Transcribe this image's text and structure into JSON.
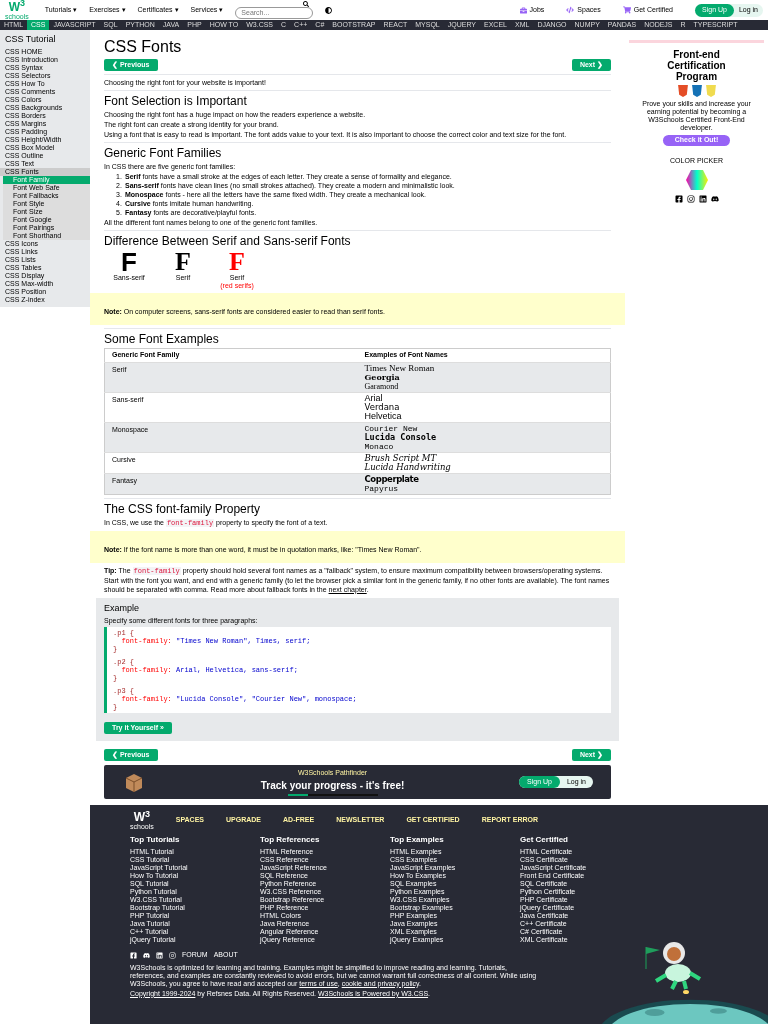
{
  "header": {
    "logo": {
      "mark": "W$^{3}$",
      "word": "schools"
    },
    "menus": [
      "Tutorials ▾",
      "Exercises ▾",
      "Certificates ▾",
      "Services ▾"
    ],
    "search": {
      "placeholder": "Search..."
    },
    "links": [
      {
        "label": "Jobs",
        "kind": "jobs"
      },
      {
        "label": "Spaces",
        "kind": "spaces"
      },
      {
        "label": "Get Certified",
        "kind": "cart"
      }
    ],
    "sign_up": "Sign Up",
    "log_in": "Log in"
  },
  "topics": [
    {
      "label": "HTML",
      "selected": false
    },
    {
      "label": "CSS",
      "selected": true
    },
    {
      "label": "JAVASCRIPT",
      "selected": false
    },
    {
      "label": "SQL",
      "selected": false
    },
    {
      "label": "PYTHON",
      "selected": false
    },
    {
      "label": "JAVA",
      "selected": false
    },
    {
      "label": "PHP",
      "selected": false
    },
    {
      "label": "HOW TO",
      "selected": false
    },
    {
      "label": "W3.CSS",
      "selected": false
    },
    {
      "label": "C",
      "selected": false
    },
    {
      "label": "C++",
      "selected": false
    },
    {
      "label": "C#",
      "selected": false
    },
    {
      "label": "BOOTSTRAP",
      "selected": false
    },
    {
      "label": "REACT",
      "selected": false
    },
    {
      "label": "MYSQL",
      "selected": false
    },
    {
      "label": "JQUERY",
      "selected": false
    },
    {
      "label": "EXCEL",
      "selected": false
    },
    {
      "label": "XML",
      "selected": false
    },
    {
      "label": "DJANGO",
      "selected": false
    },
    {
      "label": "NUMPY",
      "selected": false
    },
    {
      "label": "PANDAS",
      "selected": false
    },
    {
      "label": "NODEJS",
      "selected": false
    },
    {
      "label": "R",
      "selected": false
    },
    {
      "label": "TYPESCRIPT",
      "selected": false
    }
  ],
  "sidebar": {
    "title": "CSS Tutorial",
    "items": [
      {
        "label": "CSS HOME",
        "selected": false
      },
      {
        "label": "CSS Introduction",
        "selected": false
      },
      {
        "label": "CSS Syntax",
        "selected": false
      },
      {
        "label": "CSS Selectors",
        "selected": false
      },
      {
        "label": "CSS How To",
        "selected": false
      },
      {
        "label": "CSS Comments",
        "selected": false
      },
      {
        "label": "CSS Colors",
        "selected": false
      },
      {
        "label": "CSS Backgrounds",
        "selected": false
      },
      {
        "label": "CSS Borders",
        "selected": false
      },
      {
        "label": "CSS Margins",
        "selected": false
      },
      {
        "label": "CSS Padding",
        "selected": false
      },
      {
        "label": "CSS Height/Width",
        "selected": false
      },
      {
        "label": "CSS Box Model",
        "selected": false
      },
      {
        "label": "CSS Outline",
        "selected": false
      },
      {
        "label": "CSS Text",
        "selected": false
      },
      {
        "label": "CSS Fonts",
        "selected": false,
        "expanded": true,
        "children": [
          {
            "label": "Font Family",
            "selected": true
          },
          {
            "label": "Font Web Safe",
            "selected": false
          },
          {
            "label": "Font Fallbacks",
            "selected": false
          },
          {
            "label": "Font Style",
            "selected": false
          },
          {
            "label": "Font Size",
            "selected": false
          },
          {
            "label": "Font Google",
            "selected": false
          },
          {
            "label": "Font Pairings",
            "selected": false
          },
          {
            "label": "Font Shorthand",
            "selected": false
          }
        ]
      },
      {
        "label": "CSS Icons",
        "selected": false
      },
      {
        "label": "CSS Links",
        "selected": false
      },
      {
        "label": "CSS Lists",
        "selected": false
      },
      {
        "label": "CSS Tables",
        "selected": false
      },
      {
        "label": "CSS Display",
        "selected": false
      },
      {
        "label": "CSS Max-width",
        "selected": false
      },
      {
        "label": "CSS Position",
        "selected": false
      },
      {
        "label": "CSS Z-index",
        "selected": false
      }
    ]
  },
  "title": "CSS Fonts",
  "previous": "❮ Previous",
  "next": "Next ❯",
  "intro": "Choosing the right font for your website is important!",
  "selection": {
    "heading": "Font Selection is Important",
    "paragraphs": [
      "Choosing the right font has a huge impact on how the readers experience a website.",
      "The right font can create a strong identity for your brand.",
      "Using a font that is easy to read is important. The font adds value to your text. It is also important to choose the correct color and text size for the font."
    ]
  },
  "generic": {
    "heading": "Generic Font Families",
    "intro": "In CSS there are five generic font families:",
    "items": [
      {
        "number": "1.",
        "text": "**Serif** fonts have a small stroke at the edges of each letter. They create a sense of formality and elegance."
      },
      {
        "number": "2.",
        "text": "**Sans-serif** fonts have clean lines (no small strokes attached). They create a modern and minimalistic look."
      },
      {
        "number": "3.",
        "text": "**Monospace** fonts - here all the letters have the same fixed width. They create a mechanical look."
      },
      {
        "number": "4.",
        "text": "**Cursive** fonts imitate human handwriting."
      },
      {
        "number": "5.",
        "text": "**Fantasy** fonts are decorative/playful fonts."
      }
    ],
    "outro": "All the different font names belong to one of the generic font families."
  },
  "difference": {
    "heading": "Difference Between Serif and Sans-serif Fonts",
    "samples": [
      {
        "letter": "F",
        "kind": "sans",
        "label": "Sans-serif"
      },
      {
        "letter": "F",
        "kind": "serif",
        "label": "Serif"
      },
      {
        "letter": "F",
        "kind": "red",
        "label": "Serif",
        "sublabel": "(red serifs)"
      }
    ],
    "note": "**Note:** On computer screens, sans-serif fonts are considered easier to read than serif fonts."
  },
  "examples": {
    "heading": "Some Font Examples",
    "columns": [
      "Generic Font Family",
      "Examples of Font Names"
    ],
    "rows": [
      {
        "family": "Serif",
        "fonts": [
          {
            "name": "Times New Roman",
            "kind": "serif"
          },
          {
            "name": "Georgia",
            "kind": "serif_bold"
          },
          {
            "name": "Garamond",
            "kind": "serif_small"
          }
        ]
      },
      {
        "family": "Sans-serif",
        "fonts": [
          {
            "name": "Arial",
            "kind": "sans"
          },
          {
            "name": "Verdana",
            "kind": "sans_wide"
          },
          {
            "name": "Helvetica",
            "kind": "sans"
          }
        ]
      },
      {
        "family": "Monospace",
        "fonts": [
          {
            "name": "Courier New",
            "kind": "mono"
          },
          {
            "name": "Lucida Console",
            "kind": "mono_bold"
          },
          {
            "name": "Monaco",
            "kind": "mono"
          }
        ]
      },
      {
        "family": "Cursive",
        "fonts": [
          {
            "name": "Brush Script MT",
            "kind": "cursive"
          },
          {
            "name": "Lucida Handwriting",
            "kind": "cursive"
          }
        ]
      },
      {
        "family": "Fantasy",
        "fonts": [
          {
            "name": "Copperplate",
            "kind": "fantasy"
          },
          {
            "name": "Papyrus",
            "kind": "mono"
          }
        ]
      }
    ]
  },
  "property": {
    "heading": "The CSS font-family Property",
    "intro": [
      {
        "kind": "text",
        "text": "In CSS, we use the "
      },
      {
        "kind": "code",
        "text": "font-family"
      },
      {
        "kind": "text",
        "text": " property to specify the font of a text."
      }
    ],
    "note": "**Note:** If the font name is more than one word, it must be in quotation marks, like: \"Times New Roman\".",
    "tip": [
      {
        "kind": "text",
        "text": "**Tip:** The "
      },
      {
        "kind": "code",
        "text": "font-family"
      },
      {
        "kind": "text",
        "text": " property should hold several font names as a \"fallback\" system, to ensure maximum compatibility between browsers/operating systems. Start with the font you want, and end with a generic family (to let the browser pick a similar font in the generic family, if no other fonts are available). The font names should be separated with comma. Read more about fallback fonts in the "
      },
      {
        "kind": "link",
        "text": "next chapter"
      },
      {
        "kind": "text",
        "text": "."
      }
    ],
    "example": {
      "heading": "Example",
      "text": "Specify some different fonts for three paragraphs:",
      "code": [
        [
          [
            {
              "kind": "selector",
              "text": ".p1 {"
            }
          ],
          [
            {
              "kind": "property",
              "text": "  font-family:"
            },
            {
              "kind": "value",
              "text": " \"Times New Roman\", Times, serif;"
            }
          ],
          [
            {
              "kind": "selector",
              "text": "}"
            }
          ]
        ],
        [
          [
            {
              "kind": "selector",
              "text": ".p2 {"
            }
          ],
          [
            {
              "kind": "property",
              "text": "  font-family:"
            },
            {
              "kind": "value",
              "text": " Arial, Helvetica, sans-serif;"
            }
          ],
          [
            {
              "kind": "selector",
              "text": "}"
            }
          ]
        ],
        [
          [
            {
              "kind": "selector",
              "text": ".p3 {"
            }
          ],
          [
            {
              "kind": "property",
              "text": "  font-family:"
            },
            {
              "kind": "value",
              "text": " \"Lucida Console\", \"Courier New\", monospace;"
            }
          ],
          [
            {
              "kind": "selector",
              "text": "}"
            }
          ]
        ]
      ],
      "button": "Try it Yourself »"
    }
  },
  "bottom_nav": {
    "previous": "❮ Previous",
    "next": "Next ❯"
  },
  "banner": {
    "kicker": "W3Schools Pathfinder",
    "headline": "Track your progress - it's free!",
    "sign_up": "Sign Up",
    "log_in": "Log in"
  },
  "ad": {
    "title": "Front-end Certification Program",
    "text": "Prove your skills and increase your earning potential by becoming a W3Schools Certified Front-End developer.",
    "button": "Check it Out!",
    "picker": "COLOR PICKER"
  },
  "footer": {
    "logo": {
      "mark": "W$^{3}$",
      "word": "schools"
    },
    "nav": [
      "SPACES",
      "UPGRADE",
      "AD-FREE",
      "NEWSLETTER",
      "GET CERTIFIED",
      "REPORT ERROR"
    ],
    "columns": [
      {
        "heading": "Top Tutorials",
        "links": [
          "HTML Tutorial",
          "CSS Tutorial",
          "JavaScript Tutorial",
          "How To Tutorial",
          "SQL Tutorial",
          "Python Tutorial",
          "W3.CSS Tutorial",
          "Bootstrap Tutorial",
          "PHP Tutorial",
          "Java Tutorial",
          "C++ Tutorial",
          "jQuery Tutorial"
        ]
      },
      {
        "heading": "Top References",
        "links": [
          "HTML Reference",
          "CSS Reference",
          "JavaScript Reference",
          "SQL Reference",
          "Python Reference",
          "W3.CSS Reference",
          "Bootstrap Reference",
          "PHP Reference",
          "HTML Colors",
          "Java Reference",
          "Angular Reference",
          "jQuery Reference"
        ]
      },
      {
        "heading": "Top Examples",
        "links": [
          "HTML Examples",
          "CSS Examples",
          "JavaScript Examples",
          "How To Examples",
          "SQL Examples",
          "Python Examples",
          "W3.CSS Examples",
          "Bootstrap Examples",
          "PHP Examples",
          "Java Examples",
          "XML Examples",
          "jQuery Examples"
        ]
      },
      {
        "heading": "Get Certified",
        "links": [
          "HTML Certificate",
          "CSS Certificate",
          "JavaScript Certificate",
          "Front End Certificate",
          "SQL Certificate",
          "Python Certificate",
          "PHP Certificate",
          "jQuery Certificate",
          "Java Certificate",
          "C++ Certificate",
          "C# Certificate",
          "XML Certificate"
        ]
      }
    ],
    "social_links": [
      "FORUM",
      "ABOUT"
    ],
    "disclaimer": [
      {
        "kind": "text",
        "text": "W3Schools is optimized for learning and training. Examples might be simplified to improve reading and learning. Tutorials, references, and examples are constantly reviewed to avoid errors, but we cannot warrant full correctness of all content. While using W3Schools, you agree to have read and accepted our "
      },
      {
        "kind": "link",
        "text": "terms of use"
      },
      {
        "kind": "text",
        "text": ", "
      },
      {
        "kind": "link",
        "text": "cookie and privacy policy"
      },
      {
        "kind": "text",
        "text": "."
      }
    ],
    "copyright": [
      {
        "kind": "link",
        "text": "Copyright 1999-2024"
      },
      {
        "kind": "text",
        "text": " by Refsnes Data. All Rights Reserved. "
      },
      {
        "kind": "link",
        "text": "W3Schools is Powered by W3.CSS"
      },
      {
        "kind": "text",
        "text": "."
      }
    ]
  }
}
